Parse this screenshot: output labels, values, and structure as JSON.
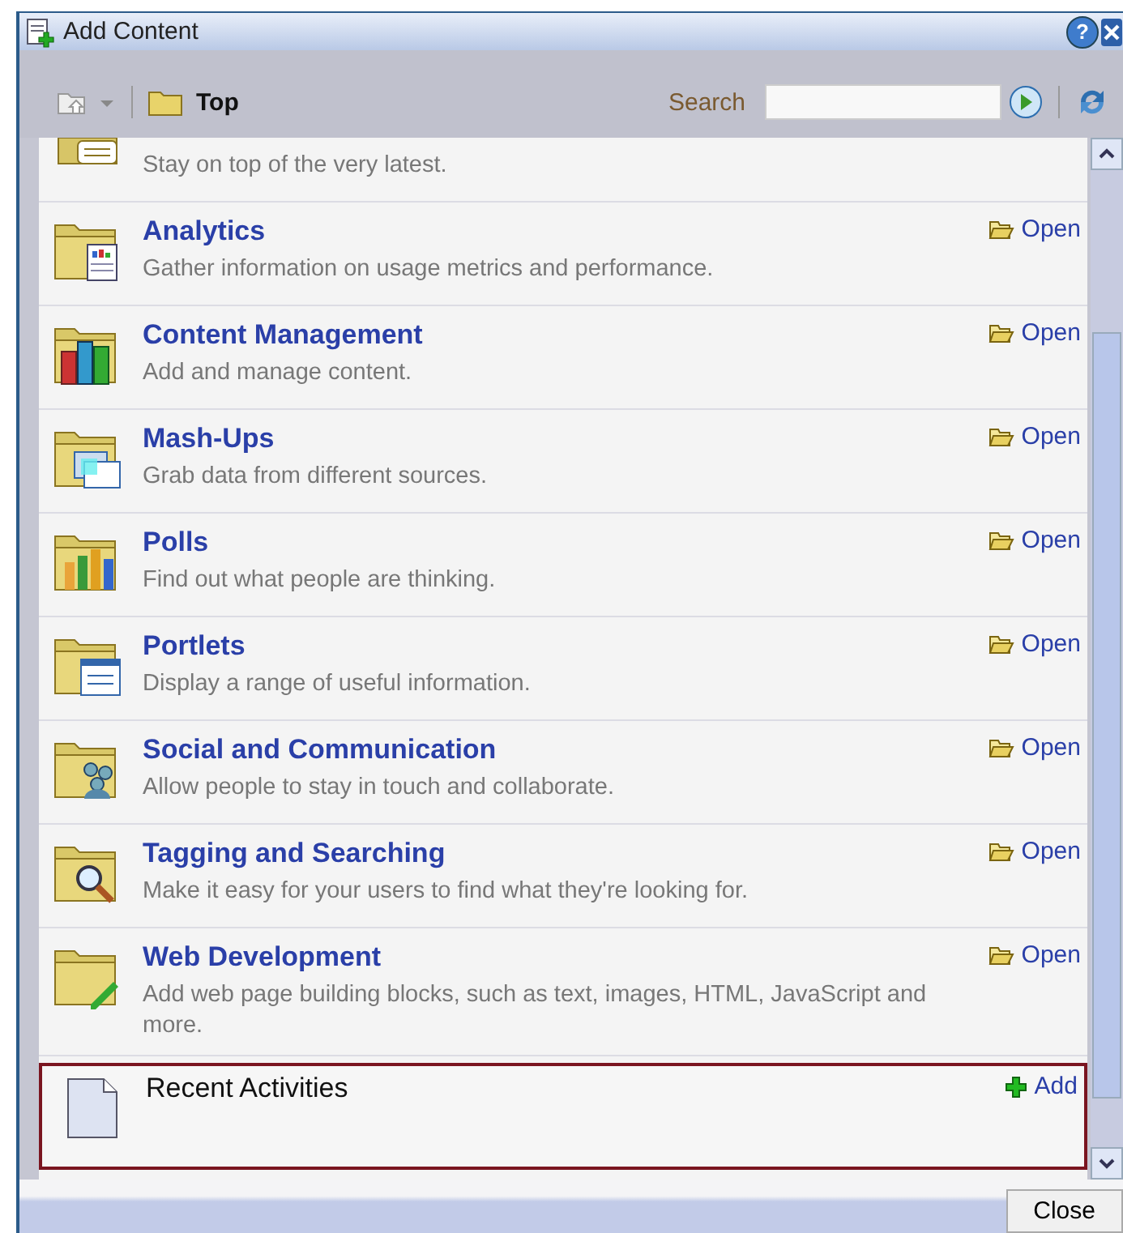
{
  "window": {
    "title": "Add Content",
    "help": "?"
  },
  "toolbar": {
    "location": "Top",
    "search_label": "Search"
  },
  "partial_row": {
    "description": "Stay on top of the very latest."
  },
  "items": [
    {
      "kind": "folder",
      "title": "Analytics",
      "description": "Gather information on usage metrics and performance.",
      "action": "Open",
      "selected": false
    },
    {
      "kind": "folder",
      "title": "Content Management",
      "description": "Add and manage content.",
      "action": "Open",
      "selected": false
    },
    {
      "kind": "folder",
      "title": "Mash-Ups",
      "description": "Grab data from different sources.",
      "action": "Open",
      "selected": false
    },
    {
      "kind": "folder",
      "title": "Polls",
      "description": "Find out what people are thinking.",
      "action": "Open",
      "selected": false
    },
    {
      "kind": "folder",
      "title": "Portlets",
      "description": "Display a range of useful information.",
      "action": "Open",
      "selected": false
    },
    {
      "kind": "folder",
      "title": "Social and Communication",
      "description": "Allow people to stay in touch and collaborate.",
      "action": "Open",
      "selected": false
    },
    {
      "kind": "folder",
      "title": "Tagging and Searching",
      "description": "Make it easy for your users to find what they're looking for.",
      "action": "Open",
      "selected": false
    },
    {
      "kind": "folder",
      "title": "Web Development",
      "description": "Add web page building blocks, such as text, images, HTML, JavaScript and more.",
      "action": "Open",
      "selected": false
    },
    {
      "kind": "item",
      "title": "Recent Activities",
      "action": "Add",
      "selected": true
    }
  ],
  "footer": {
    "close": "Close"
  }
}
